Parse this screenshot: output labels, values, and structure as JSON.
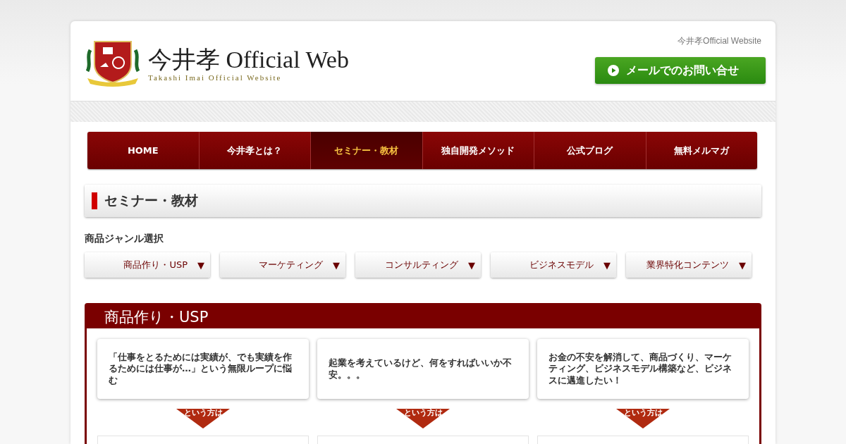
{
  "header": {
    "logo_title": "今井孝 Official Web",
    "logo_subtitle": "Takashi Imai Official Website",
    "tagline": "今井孝Official Website",
    "contact_button": "メールでのお問い合せ"
  },
  "nav": [
    {
      "label": "HOME",
      "selected": false
    },
    {
      "label": "今井孝とは？",
      "selected": false
    },
    {
      "label": "セミナー・教材",
      "selected": true
    },
    {
      "label": "独自開発メソッド",
      "selected": false
    },
    {
      "label": "公式ブログ",
      "selected": false
    },
    {
      "label": "無料メルマガ",
      "selected": false
    }
  ],
  "page_title": "セミナー・教材",
  "genre": {
    "label": "商品ジャンル選択",
    "options": [
      {
        "label": "商品作り・USP",
        "arrow": "▼"
      },
      {
        "label": "マーケティング",
        "arrow": "▼"
      },
      {
        "label": "コンサルティング",
        "arrow": "▼"
      },
      {
        "label": "ビジネスモデル",
        "arrow": "▼"
      },
      {
        "label": "業界特化コンテンツ",
        "arrow": "▼"
      }
    ]
  },
  "section": {
    "title": "商品作り・USP",
    "columns": [
      {
        "concern": "「仕事をとるためには実績が、でも実績を作るためには仕事が…」という無限ループに悩む",
        "arrow_label": "という方は"
      },
      {
        "concern": "起業を考えているけど、何をすればいいか不安。。。",
        "arrow_label": "という方は"
      },
      {
        "concern": "お金の不安を解消して、商品づくり、マーケティング、ビジネスモデル構築など、ビジネスに邁進したい！",
        "arrow_label": "という方は"
      }
    ]
  }
}
